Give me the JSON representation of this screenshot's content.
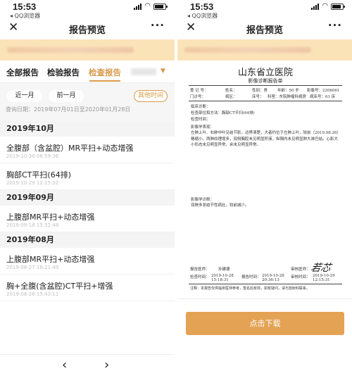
{
  "status": {
    "time": "15:53",
    "carrier": "◂ QQ浏览器"
  },
  "nav": {
    "close": "✕",
    "title": "报告预览",
    "more": "···"
  },
  "tabs": [
    {
      "label": "全部报告",
      "active": false
    },
    {
      "label": "检验报告",
      "active": false
    },
    {
      "label": "检查报告",
      "active": true
    }
  ],
  "tab_arrow": "▼",
  "filters": {
    "recent_month": "近一月",
    "prev_month": "前一月",
    "other_time": "其他时间",
    "query_date": "查询日期：2019年07月01日至2020年01月28日"
  },
  "groups": [
    {
      "month": "2019年10月",
      "items": [
        {
          "name": "全腹部（含盆腔）MR平扫+动态增强",
          "date": "2019-10-30 08:59:36"
        },
        {
          "name": "胸部CT平扫(64排)",
          "date": "2019-10-29 12:15:32"
        }
      ]
    },
    {
      "month": "2019年09月",
      "items": [
        {
          "name": "上腹部MR平扫+动态增强",
          "date": "2019-09-18 15:32:48"
        }
      ]
    },
    {
      "month": "2019年08月",
      "items": [
        {
          "name": "上腹部MR平扫+动态增强",
          "date": "2019-08-27 16:21:49"
        },
        {
          "name": "胸+全腹(含盆腔)CT平扫+增强",
          "date": "2019-08-26 15:43:11"
        }
      ]
    }
  ],
  "pager": {
    "prev": "‹",
    "next": "›"
  },
  "report": {
    "hospital": "山东省立医院",
    "subtitle": "影像诊断报告单",
    "row1": {
      "patient_id_label": "登 记 号：",
      "name_label": "姓名：",
      "gender": "性别：男",
      "age": "年龄：50 岁",
      "image_no": "影像号：2206061"
    },
    "row2": {
      "outpatient": "门诊号：",
      "ward": "病区：",
      "bed": "床号：",
      "dept": "科室：东院肿瘤科病房",
      "bed_no": "病床号：61 床"
    },
    "clinical_dx": "临床诊断：",
    "exam_part": "检查部位和方法：胸部CT平扫(64排)",
    "exam_time": "检查时间：",
    "findings_label": "影像学表现：",
    "findings": "左肺上叶、右肺中叶见结节影，边界清楚，大者约位于左肺上叶，较前（2019.08.26）略缩小。两肺纹理增多，双侧胸腔未见明显积液，纵隔内未见明显肿大淋巴结。心影大小形态未见明显异常，余未见明显异常。",
    "conclusion_label": "影像学诊断：",
    "conclusion": "双肺多发结节性病灶，较前减少。",
    "signature_row1": {
      "reporter": "报告医师：",
      "reporter_name": "孙建德",
      "reviewer": "审核医师："
    },
    "signature_row2": {
      "exam_time": "检查时间：",
      "exam_val": "2019-10-28 15:18:31",
      "report_time": "报告时间：",
      "report_val": "2019-10-28 20:36:13",
      "review_time": "审核时间：",
      "review_val": "2019-10-29 12:15:31"
    },
    "footnote": "注释：本报告仅供临床医师参考，签名后有效，如有疑问，请与放射科联系。",
    "signature": "若芯"
  },
  "download": "点击下载"
}
